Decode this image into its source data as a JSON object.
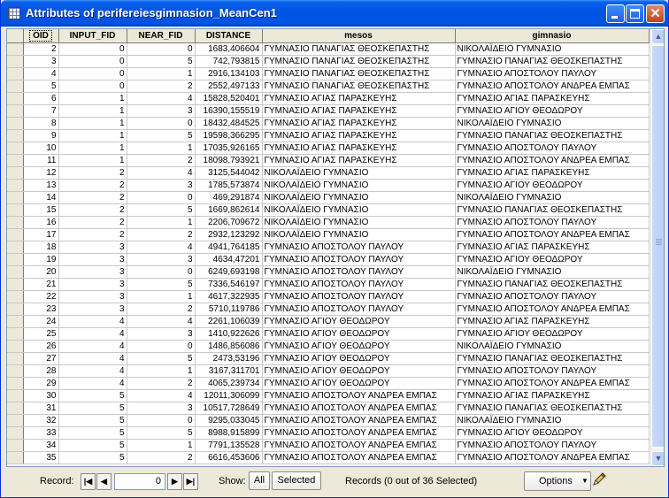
{
  "window": {
    "title": "Attributes of perifereiesgimnasion_MeanCen1"
  },
  "table": {
    "columns": [
      "OID",
      "INPUT_FID",
      "NEAR_FID",
      "DISTANCE",
      "mesos",
      "gimnasio"
    ],
    "rows": [
      [
        "2",
        "0",
        "0",
        "1683,406604",
        "ΓΥΜΝΑΣΙΟ ΠΑΝΑΓΙΑΣ ΘΕΟΣΚΕΠΑΣΤΗΣ",
        "ΝΙΚΟΛΑΪΔΕΙΟ ΓΥΜΝΑΣΙΟ"
      ],
      [
        "3",
        "0",
        "5",
        "742,793815",
        "ΓΥΜΝΑΣΙΟ ΠΑΝΑΓΙΑΣ ΘΕΟΣΚΕΠΑΣΤΗΣ",
        "ΓΥΜΝΑΣΙΟ ΠΑΝΑΓΙΑΣ ΘΕΟΣΚΕΠΑΣΤΗΣ"
      ],
      [
        "4",
        "0",
        "1",
        "2916,134103",
        "ΓΥΜΝΑΣΙΟ ΠΑΝΑΓΙΑΣ ΘΕΟΣΚΕΠΑΣΤΗΣ",
        "ΓΥΜΝΑΣΙΟ ΑΠΟΣΤΟΛΟΥ ΠΑΥΛΟΥ"
      ],
      [
        "5",
        "0",
        "2",
        "2552,497133",
        "ΓΥΜΝΑΣΙΟ ΠΑΝΑΓΙΑΣ ΘΕΟΣΚΕΠΑΣΤΗΣ",
        "ΓΥΜΝΑΣΙΟ ΑΠΟΣΤΟΛΟΥ ΑΝΔΡΕΑ ΕΜΠΑΣ"
      ],
      [
        "6",
        "1",
        "4",
        "15828,520401",
        "ΓΥΜΝΑΣΙΟ ΑΓΙΑΣ ΠΑΡΑΣΚΕΥΗΣ",
        "ΓΥΜΝΑΣΙΟ ΑΓΙΑΣ ΠΑΡΑΣΚΕΥΗΣ"
      ],
      [
        "7",
        "1",
        "3",
        "16390,155519",
        "ΓΥΜΝΑΣΙΟ ΑΓΙΑΣ ΠΑΡΑΣΚΕΥΗΣ",
        "ΓΥΜΝΑΣΙΟ ΑΓΙΟΥ ΘΕΟΔΩΡΟΥ"
      ],
      [
        "8",
        "1",
        "0",
        "18432,484525",
        "ΓΥΜΝΑΣΙΟ ΑΓΙΑΣ ΠΑΡΑΣΚΕΥΗΣ",
        "ΝΙΚΟΛΑΪΔΕΙΟ ΓΥΜΝΑΣΙΟ"
      ],
      [
        "9",
        "1",
        "5",
        "19598,366295",
        "ΓΥΜΝΑΣΙΟ ΑΓΙΑΣ ΠΑΡΑΣΚΕΥΗΣ",
        "ΓΥΜΝΑΣΙΟ ΠΑΝΑΓΙΑΣ ΘΕΟΣΚΕΠΑΣΤΗΣ"
      ],
      [
        "10",
        "1",
        "1",
        "17035,926165",
        "ΓΥΜΝΑΣΙΟ ΑΓΙΑΣ ΠΑΡΑΣΚΕΥΗΣ",
        "ΓΥΜΝΑΣΙΟ ΑΠΟΣΤΟΛΟΥ ΠΑΥΛΟΥ"
      ],
      [
        "11",
        "1",
        "2",
        "18098,793921",
        "ΓΥΜΝΑΣΙΟ ΑΓΙΑΣ ΠΑΡΑΣΚΕΥΗΣ",
        "ΓΥΜΝΑΣΙΟ ΑΠΟΣΤΟΛΟΥ ΑΝΔΡΕΑ ΕΜΠΑΣ"
      ],
      [
        "12",
        "2",
        "4",
        "3125,544042",
        "ΝΙΚΟΛΑΪΔΕΙΟ ΓΥΜΝΑΣΙΟ",
        "ΓΥΜΝΑΣΙΟ ΑΓΙΑΣ ΠΑΡΑΣΚΕΥΗΣ"
      ],
      [
        "13",
        "2",
        "3",
        "1785,573874",
        "ΝΙΚΟΛΑΪΔΕΙΟ ΓΥΜΝΑΣΙΟ",
        "ΓΥΜΝΑΣΙΟ ΑΓΙΟΥ ΘΕΟΔΩΡΟΥ"
      ],
      [
        "14",
        "2",
        "0",
        "469,291874",
        "ΝΙΚΟΛΑΪΔΕΙΟ ΓΥΜΝΑΣΙΟ",
        "ΝΙΚΟΛΑΪΔΕΙΟ ΓΥΜΝΑΣΙΟ"
      ],
      [
        "15",
        "2",
        "5",
        "1669,862614",
        "ΝΙΚΟΛΑΪΔΕΙΟ ΓΥΜΝΑΣΙΟ",
        "ΓΥΜΝΑΣΙΟ ΠΑΝΑΓΙΑΣ ΘΕΟΣΚΕΠΑΣΤΗΣ"
      ],
      [
        "16",
        "2",
        "1",
        "2206,709672",
        "ΝΙΚΟΛΑΪΔΕΙΟ ΓΥΜΝΑΣΙΟ",
        "ΓΥΜΝΑΣΙΟ ΑΠΟΣΤΟΛΟΥ ΠΑΥΛΟΥ"
      ],
      [
        "17",
        "2",
        "2",
        "2932,123292",
        "ΝΙΚΟΛΑΪΔΕΙΟ ΓΥΜΝΑΣΙΟ",
        "ΓΥΜΝΑΣΙΟ ΑΠΟΣΤΟΛΟΥ ΑΝΔΡΕΑ ΕΜΠΑΣ"
      ],
      [
        "18",
        "3",
        "4",
        "4941,764185",
        "ΓΥΜΝΑΣΙΟ ΑΠΟΣΤΟΛΟΥ ΠΑΥΛΟΥ",
        "ΓΥΜΝΑΣΙΟ ΑΓΙΑΣ ΠΑΡΑΣΚΕΥΗΣ"
      ],
      [
        "19",
        "3",
        "3",
        "4634,47201",
        "ΓΥΜΝΑΣΙΟ ΑΠΟΣΤΟΛΟΥ ΠΑΥΛΟΥ",
        "ΓΥΜΝΑΣΙΟ ΑΓΙΟΥ ΘΕΟΔΩΡΟΥ"
      ],
      [
        "20",
        "3",
        "0",
        "6249,693198",
        "ΓΥΜΝΑΣΙΟ ΑΠΟΣΤΟΛΟΥ ΠΑΥΛΟΥ",
        "ΝΙΚΟΛΑΪΔΕΙΟ ΓΥΜΝΑΣΙΟ"
      ],
      [
        "21",
        "3",
        "5",
        "7336,546197",
        "ΓΥΜΝΑΣΙΟ ΑΠΟΣΤΟΛΟΥ ΠΑΥΛΟΥ",
        "ΓΥΜΝΑΣΙΟ ΠΑΝΑΓΙΑΣ ΘΕΟΣΚΕΠΑΣΤΗΣ"
      ],
      [
        "22",
        "3",
        "1",
        "4617,322935",
        "ΓΥΜΝΑΣΙΟ ΑΠΟΣΤΟΛΟΥ ΠΑΥΛΟΥ",
        "ΓΥΜΝΑΣΙΟ ΑΠΟΣΤΟΛΟΥ ΠΑΥΛΟΥ"
      ],
      [
        "23",
        "3",
        "2",
        "5710,119786",
        "ΓΥΜΝΑΣΙΟ ΑΠΟΣΤΟΛΟΥ ΠΑΥΛΟΥ",
        "ΓΥΜΝΑΣΙΟ ΑΠΟΣΤΟΛΟΥ ΑΝΔΡΕΑ ΕΜΠΑΣ"
      ],
      [
        "24",
        "4",
        "4",
        "2261,106039",
        "ΓΥΜΝΑΣΙΟ ΑΓΙΟΥ ΘΕΟΔΩΡΟΥ",
        "ΓΥΜΝΑΣΙΟ ΑΓΙΑΣ ΠΑΡΑΣΚΕΥΗΣ"
      ],
      [
        "25",
        "4",
        "3",
        "1410,922626",
        "ΓΥΜΝΑΣΙΟ ΑΓΙΟΥ ΘΕΟΔΩΡΟΥ",
        "ΓΥΜΝΑΣΙΟ ΑΓΙΟΥ ΘΕΟΔΩΡΟΥ"
      ],
      [
        "26",
        "4",
        "0",
        "1486,856086",
        "ΓΥΜΝΑΣΙΟ ΑΓΙΟΥ ΘΕΟΔΩΡΟΥ",
        "ΝΙΚΟΛΑΪΔΕΙΟ ΓΥΜΝΑΣΙΟ"
      ],
      [
        "27",
        "4",
        "5",
        "2473,53196",
        "ΓΥΜΝΑΣΙΟ ΑΓΙΟΥ ΘΕΟΔΩΡΟΥ",
        "ΓΥΜΝΑΣΙΟ ΠΑΝΑΓΙΑΣ ΘΕΟΣΚΕΠΑΣΤΗΣ"
      ],
      [
        "28",
        "4",
        "1",
        "3167,311701",
        "ΓΥΜΝΑΣΙΟ ΑΓΙΟΥ ΘΕΟΔΩΡΟΥ",
        "ΓΥΜΝΑΣΙΟ ΑΠΟΣΤΟΛΟΥ ΠΑΥΛΟΥ"
      ],
      [
        "29",
        "4",
        "2",
        "4065,239734",
        "ΓΥΜΝΑΣΙΟ ΑΓΙΟΥ ΘΕΟΔΩΡΟΥ",
        "ΓΥΜΝΑΣΙΟ ΑΠΟΣΤΟΛΟΥ ΑΝΔΡΕΑ ΕΜΠΑΣ"
      ],
      [
        "30",
        "5",
        "4",
        "12011,306099",
        "ΓΥΜΝΑΣΙΟ ΑΠΟΣΤΟΛΟΥ ΑΝΔΡΕΑ ΕΜΠΑΣ",
        "ΓΥΜΝΑΣΙΟ ΑΓΙΑΣ ΠΑΡΑΣΚΕΥΗΣ"
      ],
      [
        "31",
        "5",
        "3",
        "10517,728649",
        "ΓΥΜΝΑΣΙΟ ΑΠΟΣΤΟΛΟΥ ΑΝΔΡΕΑ ΕΜΠΑΣ",
        "ΓΥΜΝΑΣΙΟ ΠΑΝΑΓΙΑΣ ΘΕΟΣΚΕΠΑΣΤΗΣ"
      ],
      [
        "32",
        "5",
        "0",
        "9295,033045",
        "ΓΥΜΝΑΣΙΟ ΑΠΟΣΤΟΛΟΥ ΑΝΔΡΕΑ ΕΜΠΑΣ",
        "ΝΙΚΟΛΑΪΔΕΙΟ ΓΥΜΝΑΣΙΟ"
      ],
      [
        "33",
        "5",
        "5",
        "8988,915899",
        "ΓΥΜΝΑΣΙΟ ΑΠΟΣΤΟΛΟΥ ΑΝΔΡΕΑ ΕΜΠΑΣ",
        "ΓΥΜΝΑΣΙΟ ΑΓΙΟΥ ΘΕΟΔΩΡΟΥ"
      ],
      [
        "34",
        "5",
        "1",
        "7791,135528",
        "ΓΥΜΝΑΣΙΟ ΑΠΟΣΤΟΛΟΥ ΑΝΔΡΕΑ ΕΜΠΑΣ",
        "ΓΥΜΝΑΣΙΟ ΑΠΟΣΤΟΛΟΥ ΠΑΥΛΟΥ"
      ],
      [
        "35",
        "5",
        "2",
        "6616,453606",
        "ΓΥΜΝΑΣΙΟ ΑΠΟΣΤΟΛΟΥ ΑΝΔΡΕΑ ΕΜΠΑΣ",
        "ΓΥΜΝΑΣΙΟ ΑΠΟΣΤΟΛΟΥ ΑΝΔΡΕΑ ΕΜΠΑΣ"
      ]
    ]
  },
  "status": {
    "record_label": "Record:",
    "record_value": "0",
    "show_label": "Show:",
    "all_label": "All",
    "selected_label": "Selected",
    "records_text": "Records (0 out of 36 Selected)",
    "options_label": "Options"
  },
  "icons": {
    "first": "first-record-icon",
    "prev": "previous-record-icon",
    "next": "next-record-icon",
    "last": "last-record-icon",
    "edit": "pencil-icon"
  },
  "colors": {
    "titlebar": "#0054E3",
    "grid_header": "#ECE9D8",
    "window_bg": "#ECE9D8"
  }
}
